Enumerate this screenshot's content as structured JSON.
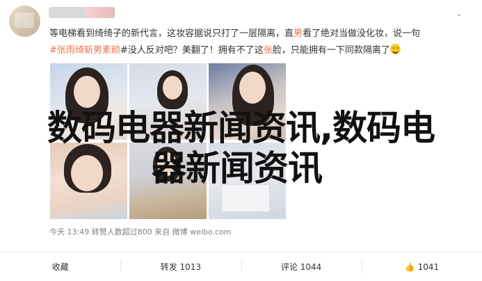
{
  "post": {
    "text_parts": {
      "p1": "等电梯看到绮绮子的新代言，这妆容据说只打了一层隔离，直",
      "p1_hl": "男",
      "p1b": "看了绝对当做没化妆，说一句",
      "tag": "#张雨绮斩男素颜",
      "p2": "#没人反对吧？美翻了！拥有不了这",
      "p2_hl": "张",
      "p2b": "脸，只能拥有一下同款隔离了"
    },
    "emoji": "smile-emoji",
    "meta": "今天 13:49 转赞人数超过800 来自 微博 weibo.com"
  },
  "overlay": {
    "line1": "数码电器新闻资讯,数码电",
    "line2": "器新闻资讯"
  },
  "actions": {
    "collect": "收藏",
    "repost": "转发 1013",
    "comment": "评论 1044",
    "like": "1041"
  },
  "icons": {
    "menu": "chevron-down-icon",
    "like": "thumbs-up-icon"
  }
}
